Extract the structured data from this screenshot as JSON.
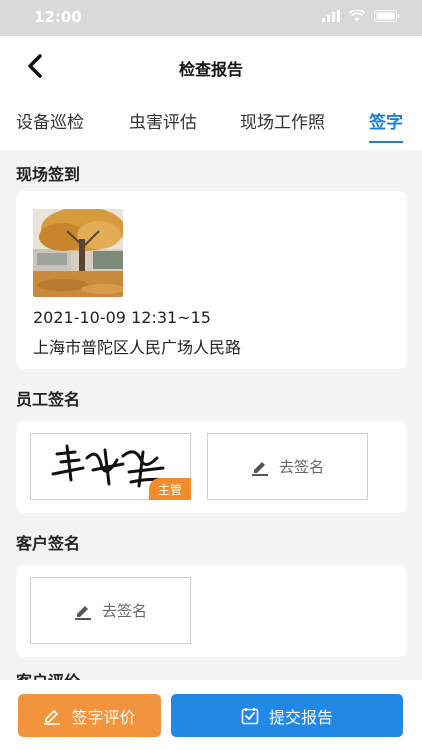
{
  "status_bar": {
    "time": "12:00"
  },
  "nav": {
    "title": "检查报告"
  },
  "tabs": [
    {
      "label": "设备巡检"
    },
    {
      "label": "虫害评估"
    },
    {
      "label": "现场工作照"
    },
    {
      "label": "签字"
    }
  ],
  "checkin": {
    "title": "现场签到",
    "datetime": "2021-10-09 12:31~15",
    "address": "上海市普陀区人民广场人民路"
  },
  "employee_sign": {
    "title": "员工签名",
    "badge": "主管",
    "empty_label": "去签名"
  },
  "customer_sign": {
    "title": "客户签名",
    "empty_label": "去签名"
  },
  "customer_review": {
    "title": "客户评价"
  },
  "actions": {
    "sign_review_label": "签字评价",
    "submit_label": "提交报告"
  },
  "colors": {
    "accent": "#1a7fd6",
    "orange": "#f2943d",
    "blue_button": "#2288e6"
  }
}
